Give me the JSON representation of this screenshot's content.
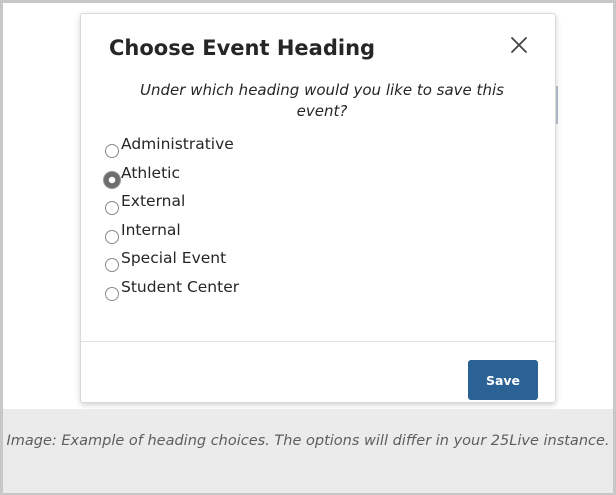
{
  "dialog": {
    "title": "Choose Event Heading",
    "prompt": "Under which heading would you like to save this event?",
    "close_icon": "close-icon",
    "options": [
      {
        "label": "Administrative",
        "checked": false
      },
      {
        "label": "Athletic",
        "checked": true
      },
      {
        "label": "External",
        "checked": false
      },
      {
        "label": "Internal",
        "checked": false
      },
      {
        "label": "Special Event",
        "checked": false
      },
      {
        "label": "Student Center",
        "checked": false
      }
    ],
    "save_label": "Save"
  },
  "caption": {
    "text": "Image: Example of heading choices. The options will differ in your 25Live instance."
  },
  "colors": {
    "save_button": "#2a6296",
    "caption_background": "#ebebeb",
    "caption_text": "#5e5e5e",
    "frame_border": "#c7c7c7"
  }
}
